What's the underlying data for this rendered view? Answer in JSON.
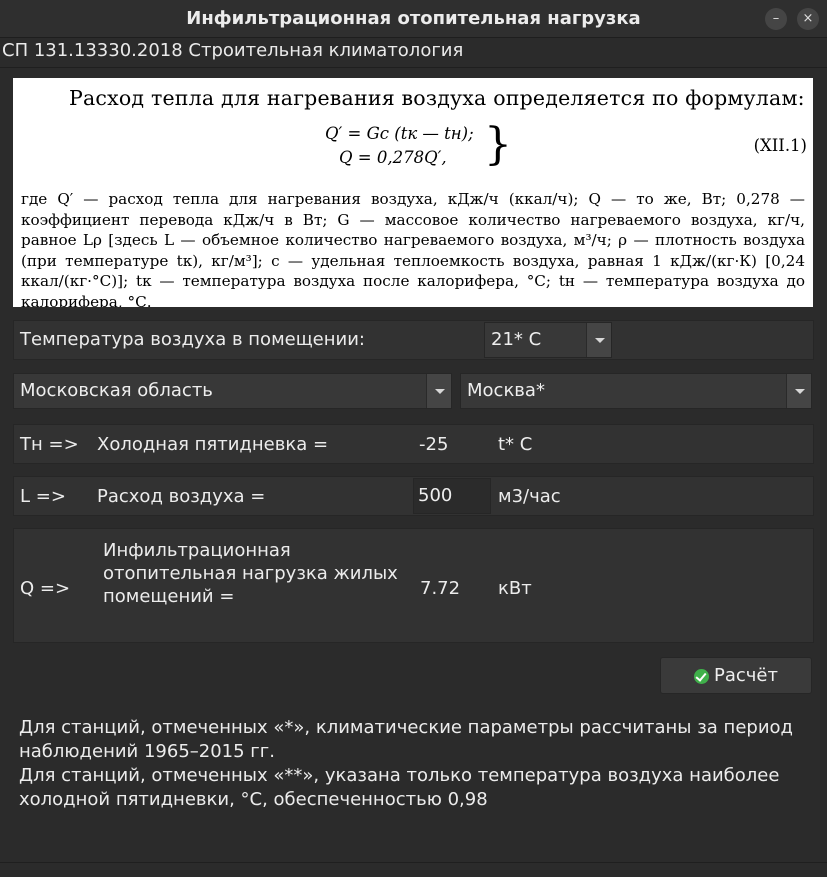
{
  "window": {
    "title": "Инфильтрационная отопительная нагрузка",
    "minimize_label": "–",
    "close_label": "×"
  },
  "subtitle": "СП 131.13330.2018 Строительная климатология",
  "formula": {
    "heading": "Расход тепла для нагревания воздуха определяется по формулам:",
    "eq1": "Q′ = Gc (tк — tн);",
    "eq2": "Q = 0,278Q′,",
    "brace": "}",
    "number": "(XII.1)",
    "body": "где Q′ — расход тепла для нагревания воздуха, кДж/ч (ккал/ч); Q — то же, Вт; 0,278 — коэффициент перевода кДж/ч в Вт; G — массовое количество нагреваемого воздуха, кг/ч, равное Lρ [здесь L — объемное количество нагреваемого воздуха, м³/ч; ρ — плотность воздуха (при температуре tк), кг/м³]; c — удельная теплоемкость воздуха, равная 1 кДж/(кг·К) [0,24 ккал/(кг·°С)]; tк — температура воздуха после калорифера, °С; tн — температура воздуха до калорифера, °С."
  },
  "room_temp": {
    "label": "Температура воздуха в помещении:",
    "value": "21* С"
  },
  "location": {
    "region": "Московская область",
    "city": "Москва*"
  },
  "tn_row": {
    "symbol": "Тн =>",
    "label": "Холодная пятидневка =",
    "value": "-25",
    "unit": "t* C"
  },
  "l_row": {
    "symbol": "L =>",
    "label": "Расход воздуха =",
    "value": "500",
    "unit": "м3/час"
  },
  "q_row": {
    "symbol": "Q =>",
    "label_line1": "Инфильтрационная",
    "label_line2": "отопительная нагрузка жилых",
    "label_line3": "помещений =",
    "value": "7.72",
    "unit": "кВт"
  },
  "calc_button": {
    "label": "Расчёт",
    "icon": "check-circle-icon",
    "icon_color": "#3fb04a"
  },
  "notes": {
    "line1": "Для станций, отмеченных «*», климатические параметры рассчитаны за период наблюдений 1965–2015 гг.",
    "line2": "Для станций, отмеченных «**», указана только температура воздуха наиболее холодной пятидневки, °С, обеспеченностью 0,98"
  }
}
